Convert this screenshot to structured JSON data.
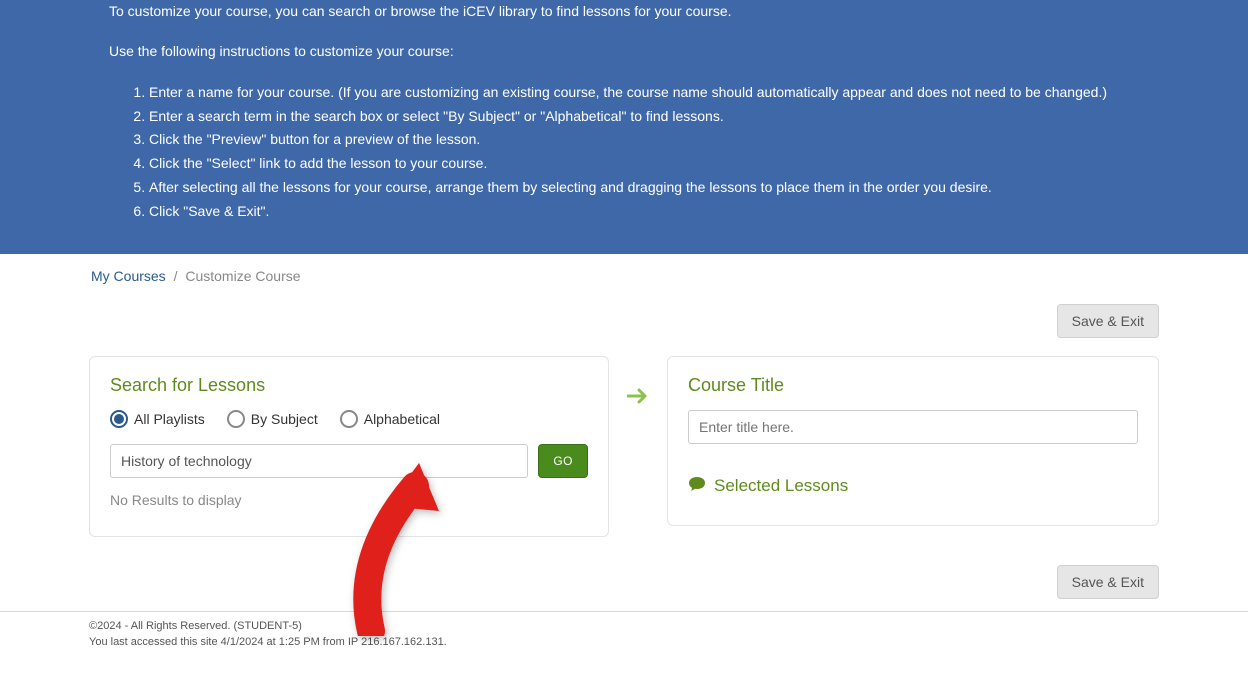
{
  "banner": {
    "intro1": "To customize your course, you can search or browse the iCEV library to find lessons for your course.",
    "intro2": "Use the following instructions to customize your course:",
    "steps": [
      "Enter a name for your course. (If you are customizing an existing course, the course name should automatically appear and does not need to be changed.)",
      "Enter a search term in the search box or select \"By Subject\" or \"Alphabetical\" to find lessons.",
      "Click the \"Preview\" button for a preview of the lesson.",
      "Click the \"Select\" link to add the lesson to your course.",
      "After selecting all the lessons for your course, arrange them by selecting and dragging the lessons to place them in the order you desire.",
      "Click \"Save & Exit\"."
    ]
  },
  "breadcrumb": {
    "root": "My Courses",
    "current": "Customize Course"
  },
  "buttons": {
    "save_exit": "Save & Exit",
    "go": "GO"
  },
  "search_panel": {
    "title": "Search for Lessons",
    "radio_all": "All Playlists",
    "radio_subject": "By Subject",
    "radio_alpha": "Alphabetical",
    "search_value": "History of technology",
    "no_results": "No Results to display"
  },
  "course_panel": {
    "title": "Course Title",
    "title_placeholder": "Enter title here.",
    "selected_lessons": "Selected Lessons"
  },
  "footer": {
    "copyright": "©2024 - All Rights Reserved. (STUDENT-5)",
    "last_access": "You last accessed this site 4/1/2024 at 1:25 PM from IP 216.167.162.131."
  }
}
